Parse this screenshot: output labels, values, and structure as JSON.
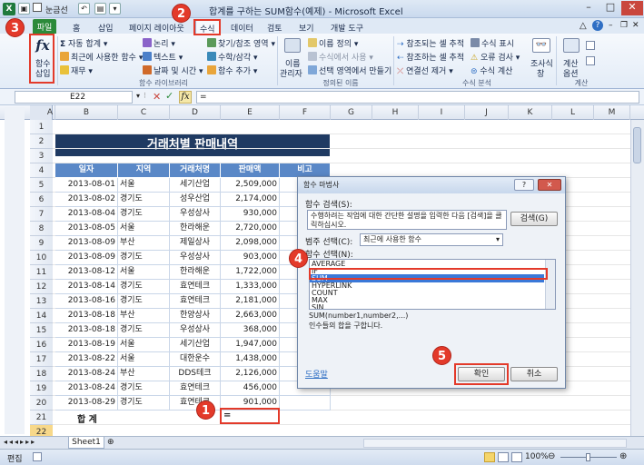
{
  "window": {
    "title": "합계를 구하는 SUM함수(예제) - Microsoft Excel",
    "qat_label": "눈금선",
    "app_icon": "X"
  },
  "tabs": [
    "파일",
    "홈",
    "삽입",
    "페이지 레이아웃",
    "수식",
    "데이터",
    "검토",
    "보기",
    "개발 도구"
  ],
  "ribbon": {
    "insert_function": {
      "line1": "함수",
      "line2": "삽입"
    },
    "library": {
      "autosum": "자동 합계",
      "recent": "최근에 사용한 함수",
      "finance": "재무",
      "logical": "논리",
      "text": "텍스트",
      "datetime": "날짜 및 시간",
      "lookup": "찾기/참조 영역",
      "math": "수학/삼각",
      "more": "함수 추가",
      "group_label": "함수 라이브러리"
    },
    "names": {
      "manager_line1": "이름",
      "manager_line2": "관리자",
      "define": "이름 정의",
      "use_in_formula": "수식에서 사용",
      "create_from_selection": "선택 영역에서 만들기",
      "group_label": "정의된 이름"
    },
    "audit": {
      "trace_precedents": "참조되는 셀 추적",
      "trace_dependents": "참조하는 셀 추적",
      "remove_arrows": "연결선 제거",
      "show_formulas": "수식 표시",
      "error_check": "오류 검사",
      "evaluate": "수식 계산",
      "watch_line1": "조사식",
      "watch_line2": "창",
      "group_label": "수식 분석"
    },
    "calc": {
      "options_line1": "계산",
      "options_line2": "옵션",
      "group_label": "계산"
    }
  },
  "formula_bar": {
    "name_box": "E22",
    "content": "="
  },
  "columns": [
    "A",
    "B",
    "C",
    "D",
    "E",
    "F",
    "G",
    "H",
    "I",
    "J",
    "K",
    "L",
    "M"
  ],
  "sheet": {
    "title": "거래처별 판매내역",
    "headers": [
      "일자",
      "지역",
      "거래처명",
      "판매액",
      "비고"
    ],
    "rows": [
      [
        "2013-08-01",
        "서울",
        "세기산업",
        "2,509,000"
      ],
      [
        "2013-08-02",
        "경기도",
        "성우산업",
        "2,174,000"
      ],
      [
        "2013-08-04",
        "경기도",
        "우성상사",
        "930,000"
      ],
      [
        "2013-08-05",
        "서울",
        "한라해운",
        "2,720,000"
      ],
      [
        "2013-08-09",
        "부산",
        "제일상사",
        "2,098,000"
      ],
      [
        "2013-08-09",
        "경기도",
        "우성상사",
        "903,000"
      ],
      [
        "2013-08-12",
        "서울",
        "한라해운",
        "1,722,000"
      ],
      [
        "2013-08-14",
        "경기도",
        "효연테크",
        "1,333,000"
      ],
      [
        "2013-08-16",
        "경기도",
        "효연테크",
        "2,181,000"
      ],
      [
        "2013-08-18",
        "부산",
        "한양상사",
        "2,663,000"
      ],
      [
        "2013-08-18",
        "경기도",
        "우성상사",
        "368,000"
      ],
      [
        "2013-08-19",
        "서울",
        "세기산업",
        "1,947,000"
      ],
      [
        "2013-08-22",
        "서울",
        "대한운수",
        "1,438,000"
      ],
      [
        "2013-08-24",
        "부산",
        "DDS테크",
        "2,126,000"
      ],
      [
        "2013-08-24",
        "경기도",
        "효연테크",
        "456,000"
      ],
      [
        "2013-08-29",
        "경기도",
        "효연테크",
        "901,000"
      ]
    ],
    "row_numbers": [
      "1",
      "2",
      "3",
      "4",
      "5",
      "6",
      "7",
      "8",
      "9",
      "10",
      "11",
      "12",
      "13",
      "14",
      "15",
      "16",
      "17",
      "18",
      "19",
      "20",
      "21",
      "22",
      "23"
    ],
    "total_label": "합  계",
    "active_cell_value": "=",
    "sheet_tab": "Sheet1"
  },
  "status": {
    "mode": "편집",
    "zoom": "100%"
  },
  "dialog": {
    "title": "함수 마법사",
    "search_label": "함수 검색(S):",
    "search_text": "수행하려는 작업에 대한 간단한 설명을 입력한 다음 [검색]을 클릭하십시오.",
    "search_button": "검색(G)",
    "category_label": "범주 선택(C):",
    "category_value": "최근에 사용한 함수",
    "select_label": "함수 선택(N):",
    "functions": [
      "AVERAGE",
      "IF",
      "SUM",
      "HYPERLINK",
      "COUNT",
      "MAX",
      "SIN"
    ],
    "selected_function": "SUM",
    "signature": "SUM(number1,number2,...)",
    "description": "인수들의 합을 구합니다.",
    "help_link": "도움말",
    "ok": "확인",
    "cancel": "취소"
  },
  "callouts": [
    "1",
    "2",
    "3",
    "4",
    "5"
  ],
  "colors": {
    "callout": "#e33a2a",
    "header_fill": "#5a88c7",
    "title_fill": "#1f3a62",
    "file_tab": "#2c8a3a",
    "selection": "#3a78d8"
  }
}
